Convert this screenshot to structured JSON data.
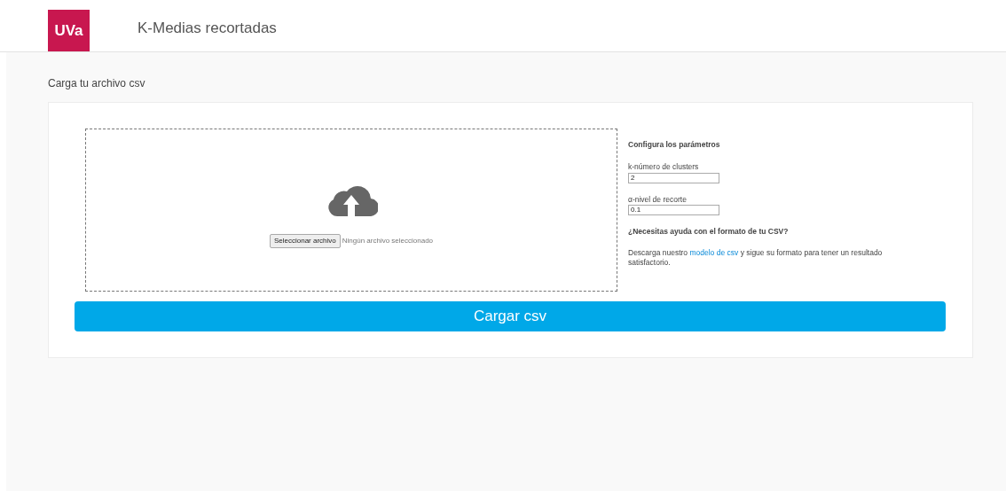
{
  "header": {
    "logo": "UVa",
    "title": "K-Medias recortadas"
  },
  "section_title": "Carga tu archivo csv",
  "upload": {
    "button": "Seleccionar archivo",
    "file_status": "Ningún archivo seleccionado"
  },
  "params": {
    "title": "Configura los parámetros",
    "fields": [
      {
        "label": "k-número de clusters",
        "value": "2"
      },
      {
        "label": "α-nivel de recorte",
        "value": "0.1"
      }
    ],
    "help_title": "¿Necesitas ayuda con el formato de tu CSV?",
    "help_text": {
      "before": "Descarga nuestro ",
      "link": "modelo de csv",
      "after": " y sigue su formato para tener un resultado satisfactorio."
    }
  },
  "submit": "Cargar csv"
}
